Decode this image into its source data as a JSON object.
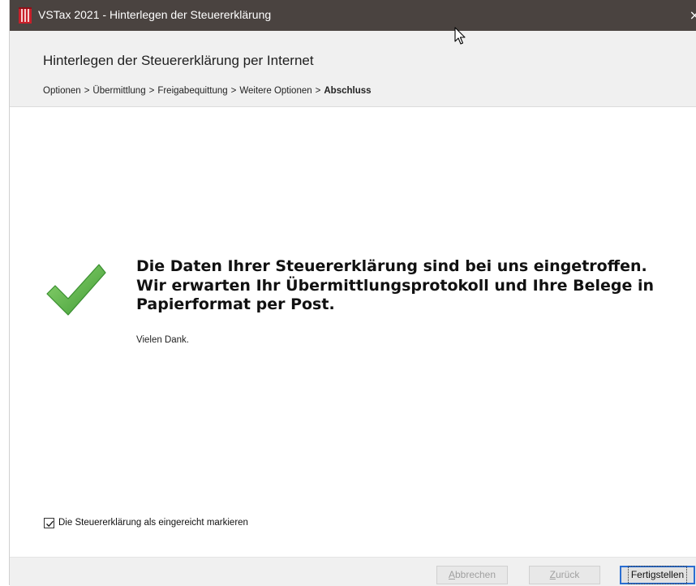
{
  "window": {
    "title": "VSTax 2021 - Hinterlegen der Steuererklärung",
    "close_symbol": "×"
  },
  "header": {
    "title": "Hinterlegen der Steuererklärung per Internet",
    "breadcrumb": {
      "steps": [
        "Optionen",
        "Übermittlung",
        "Freigabequittung",
        "Weitere Optionen"
      ],
      "separator": ">",
      "current": "Abschluss"
    }
  },
  "main": {
    "status_icon": "checkmark-icon",
    "message_lines": [
      "Die Daten Ihrer Steuererklärung sind bei uns eingetroffen.",
      "Wir erwarten Ihr Übermittlungsprotokoll und Ihre Belege in",
      "Papierformat per Post."
    ],
    "thanks": "Vielen Dank."
  },
  "checkbox": {
    "label": "Die Steuererklärung als eingereicht markieren",
    "checked": true
  },
  "footer": {
    "cancel": {
      "access_key": "A",
      "rest": "bbrechen",
      "enabled": false
    },
    "back": {
      "access_key": "Z",
      "rest": "urück",
      "enabled": false
    },
    "finish": {
      "label": "Fertigstellen",
      "enabled": true
    }
  },
  "colors": {
    "titlebar": "#4a4340",
    "header_bg": "#f0f0f0",
    "check_green": "#5fb84a",
    "focus_blue": "#2a6ed1",
    "app_icon_red": "#c8202a"
  }
}
